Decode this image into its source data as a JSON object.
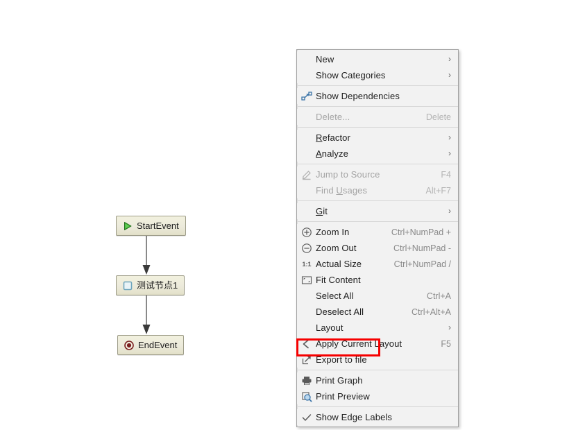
{
  "diagram": {
    "nodes": [
      {
        "id": "start",
        "label": "StartEvent",
        "icon": "play-triangle-icon"
      },
      {
        "id": "task",
        "label": "测试节点1",
        "icon": "task-square-icon"
      },
      {
        "id": "end",
        "label": "EndEvent",
        "icon": "end-circle-icon"
      }
    ],
    "edges": [
      {
        "from": "StartEvent",
        "to": "测试节点1"
      },
      {
        "from": "测试节点1",
        "to": "EndEvent"
      }
    ],
    "colors": {
      "node_fill": "#eceadb",
      "node_border": "#9b9a86",
      "start_icon": "#2fa22f",
      "task_icon": "#7fb2c6",
      "end_icon": "#7a1f1f",
      "edge": "#3a3a3a"
    }
  },
  "context_menu": {
    "groups": [
      {
        "items": [
          {
            "label": "New",
            "icon": null,
            "shortcut": "",
            "submenu": true,
            "disabled": false,
            "checked": false
          },
          {
            "label": "Show Categories",
            "icon": null,
            "shortcut": "",
            "submenu": true,
            "disabled": false,
            "checked": false
          }
        ]
      },
      {
        "items": [
          {
            "label": "Show Dependencies",
            "icon": "dependencies-icon",
            "shortcut": "",
            "submenu": false,
            "disabled": false,
            "checked": false
          }
        ]
      },
      {
        "items": [
          {
            "label": "Delete...",
            "icon": null,
            "shortcut": "Delete",
            "submenu": false,
            "disabled": true,
            "checked": false
          }
        ]
      },
      {
        "items": [
          {
            "label": "Refactor",
            "mnemonic": "R",
            "icon": null,
            "shortcut": "",
            "submenu": true,
            "disabled": false,
            "checked": false
          },
          {
            "label": "Analyze",
            "mnemonic": "A",
            "icon": null,
            "shortcut": "",
            "submenu": true,
            "disabled": false,
            "checked": false
          }
        ]
      },
      {
        "items": [
          {
            "label": "Jump to Source",
            "icon": "pencil-icon",
            "shortcut": "F4",
            "submenu": false,
            "disabled": true,
            "checked": false
          },
          {
            "label": "Find Usages",
            "mnemonic": "U",
            "icon": null,
            "shortcut": "Alt+F7",
            "submenu": false,
            "disabled": true,
            "checked": false
          }
        ]
      },
      {
        "items": [
          {
            "label": "Git",
            "mnemonic": "G",
            "icon": null,
            "shortcut": "",
            "submenu": true,
            "disabled": false,
            "checked": false
          }
        ]
      },
      {
        "items": [
          {
            "label": "Zoom In",
            "icon": "zoom-in-icon",
            "shortcut": "Ctrl+NumPad +",
            "submenu": false,
            "disabled": false,
            "checked": false
          },
          {
            "label": "Zoom Out",
            "icon": "zoom-out-icon",
            "shortcut": "Ctrl+NumPad -",
            "submenu": false,
            "disabled": false,
            "checked": false
          },
          {
            "label": "Actual Size",
            "icon": "actual-size-icon",
            "shortcut": "Ctrl+NumPad /",
            "submenu": false,
            "disabled": false,
            "checked": false
          },
          {
            "label": "Fit Content",
            "icon": "fit-content-icon",
            "shortcut": "",
            "submenu": false,
            "disabled": false,
            "checked": false
          },
          {
            "label": "Select All",
            "icon": null,
            "shortcut": "Ctrl+A",
            "submenu": false,
            "disabled": false,
            "checked": false
          },
          {
            "label": "Deselect All",
            "icon": null,
            "shortcut": "Ctrl+Alt+A",
            "submenu": false,
            "disabled": false,
            "checked": false
          },
          {
            "label": "Layout",
            "icon": null,
            "shortcut": "",
            "submenu": true,
            "disabled": false,
            "checked": false
          },
          {
            "label": "Apply Current Layout",
            "icon": "apply-layout-icon",
            "shortcut": "F5",
            "submenu": false,
            "disabled": false,
            "checked": false
          },
          {
            "label": "Export to file",
            "icon": "export-icon",
            "shortcut": "",
            "submenu": false,
            "disabled": false,
            "checked": false,
            "highlighted": true
          }
        ]
      },
      {
        "items": [
          {
            "label": "Print Graph",
            "icon": "printer-icon",
            "shortcut": "",
            "submenu": false,
            "disabled": false,
            "checked": false
          },
          {
            "label": "Print Preview",
            "icon": "print-preview-icon",
            "shortcut": "",
            "submenu": false,
            "disabled": false,
            "checked": false
          }
        ]
      },
      {
        "items": [
          {
            "label": "Show Edge Labels",
            "icon": "checkmark-icon",
            "shortcut": "",
            "submenu": false,
            "disabled": false,
            "checked": true
          }
        ]
      }
    ],
    "submenu_glyph": "›",
    "highlight_color": "#f60000"
  }
}
